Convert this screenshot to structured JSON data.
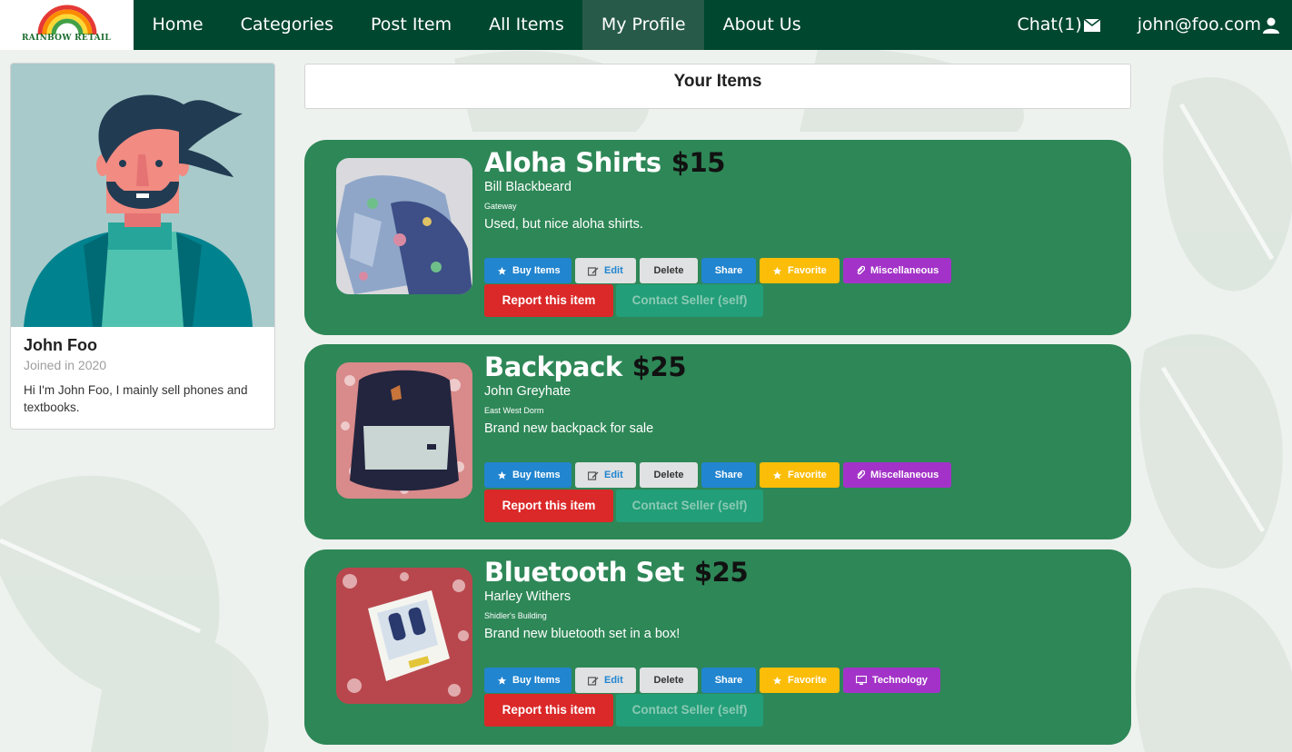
{
  "nav": {
    "logo_text": "RAINBOW RETAIL",
    "items": [
      "Home",
      "Categories",
      "Post Item",
      "All Items",
      "My Profile",
      "About Us"
    ],
    "active_index": 4,
    "chat_label": "Chat(1)",
    "chat_icon": "envelope-icon",
    "user_label": "john@foo.com",
    "user_icon": "user-icon",
    "background_color": "#004730",
    "active_color": "#275a49"
  },
  "profile": {
    "name": "John Foo",
    "joined": "Joined in 2020",
    "bio": "Hi I'm John Foo, I mainly sell phones and textbooks."
  },
  "header": {
    "title": "Your Items"
  },
  "buttons": {
    "buy": "Buy Items",
    "edit": "Edit",
    "delete": "Delete",
    "share": "Share",
    "favorite": "Favorite",
    "report": "Report this item",
    "contact": "Contact Seller (self)"
  },
  "colors": {
    "card_green": "#2e8757",
    "blue": "#2185d0",
    "yellow": "#fbbd08",
    "purple": "#a333c8",
    "red": "#db2828",
    "teal": "#21a37e"
  },
  "items": [
    {
      "title": "Aloha Shirts",
      "price": "$15",
      "seller": "Bill Blackbeard",
      "location": "Gateway",
      "description": "Used, but nice aloha shirts.",
      "category": "Miscellaneous",
      "category_icon": "paperclip-icon"
    },
    {
      "title": "Backpack",
      "price": "$25",
      "seller": "John Greyhate",
      "location": "East West Dorm",
      "description": "Brand new backpack for sale",
      "category": "Miscellaneous",
      "category_icon": "paperclip-icon"
    },
    {
      "title": "Bluetooth Set",
      "price": "$25",
      "seller": "Harley Withers",
      "location": "Shidler's Building",
      "description": "Brand new bluetooth set in a box!",
      "category": "Technology",
      "category_icon": "monitor-icon"
    }
  ]
}
